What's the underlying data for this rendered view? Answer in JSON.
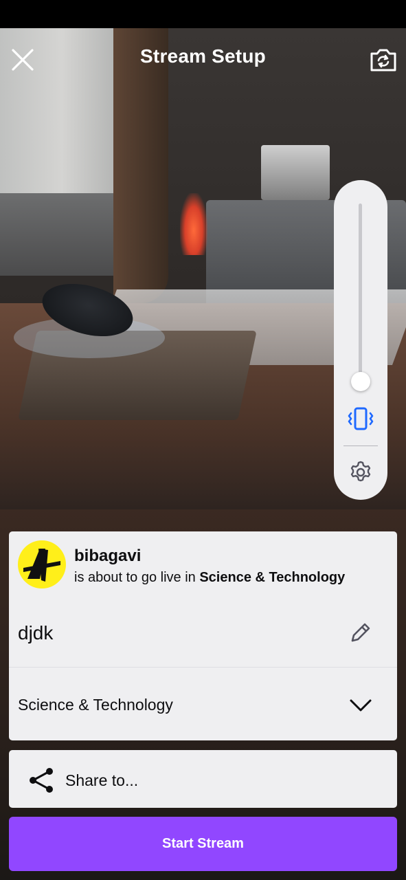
{
  "header": {
    "title": "Stream Setup",
    "close_icon": "close-icon",
    "flip_icon": "camera-flip-icon"
  },
  "controls": {
    "zoom_level": 0.0,
    "vibrate_icon": "vibrate-icon",
    "settings_icon": "gear-icon"
  },
  "stream_info": {
    "username": "bibagavi",
    "live_prefix": "is about to go live in ",
    "live_category": "Science & Technology",
    "stream_title": "djdk",
    "category": "Science & Technology"
  },
  "share": {
    "label": "Share to..."
  },
  "start": {
    "label": "Start Stream"
  },
  "colors": {
    "accent": "#9147ff",
    "panel": "#efeff1",
    "icon_blue": "#1f69ff",
    "avatar": "#ffef1a"
  }
}
